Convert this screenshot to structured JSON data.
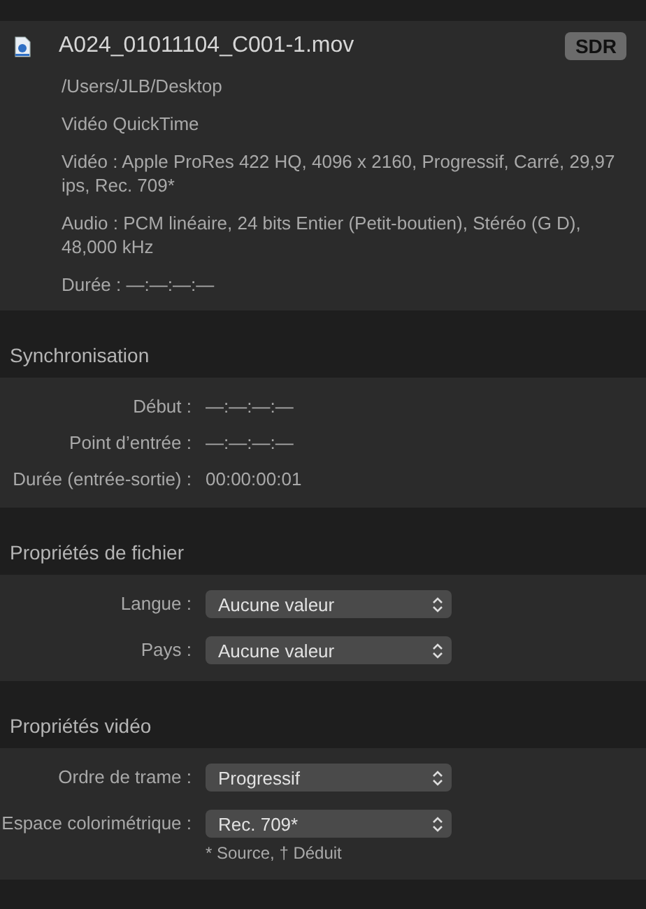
{
  "file": {
    "name": "A024_01011104_C001-1.mov",
    "badge": "SDR",
    "path": "/Users/JLB/Desktop",
    "type": "Vidéo QuickTime",
    "video": "Vidéo : Apple ProRes 422 HQ, 4096 x 2160, Progressif, Carré, 29,97 ips, Rec. 709*",
    "audio": "Audio : PCM linéaire, 24 bits Entier (Petit-boutien), Stéréo (G D), 48,000 kHz",
    "duration": "Durée : —:—:—:—"
  },
  "sections": [
    {
      "title": "Synchronisation",
      "kind": "fields",
      "rows": [
        {
          "label": "Début :",
          "value": "—:—:—:—"
        },
        {
          "label": "Point d’entrée :",
          "value": "—:—:—:—"
        },
        {
          "label": "Durée (entrée-sortie) :",
          "value": "00:00:00:01"
        }
      ]
    },
    {
      "title": "Propriétés de fichier",
      "kind": "popups",
      "rows": [
        {
          "label": "Langue :",
          "value": "Aucune valeur"
        },
        {
          "label": "Pays :",
          "value": "Aucune valeur"
        }
      ]
    },
    {
      "title": "Propriétés vidéo",
      "kind": "popups",
      "rows": [
        {
          "label": "Ordre de trame :",
          "value": "Progressif"
        },
        {
          "label": "Espace colorimétrique :",
          "value": "Rec. 709*"
        }
      ],
      "note": "* Source, † Déduit"
    }
  ]
}
